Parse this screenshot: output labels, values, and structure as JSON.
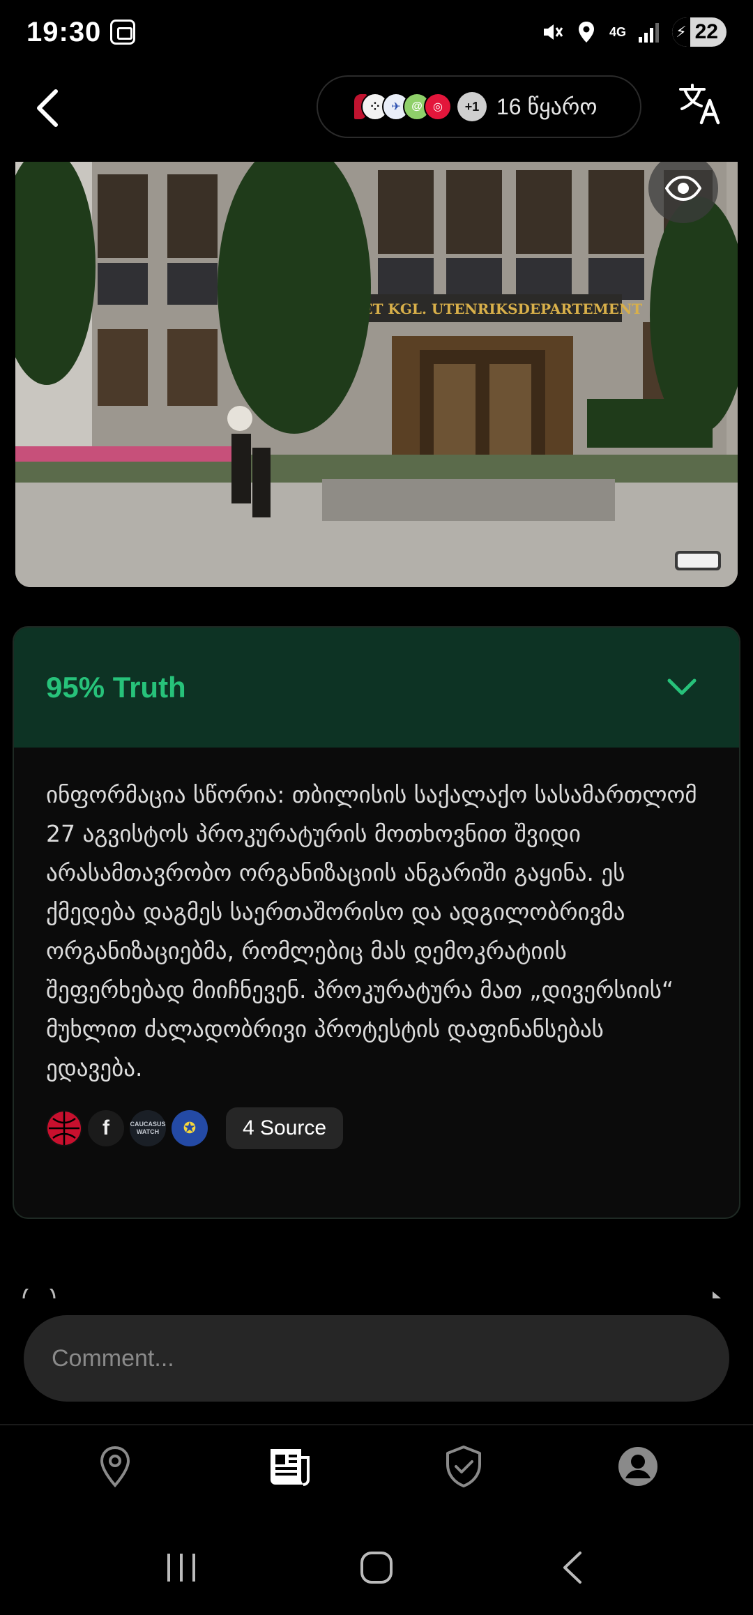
{
  "status_bar": {
    "time": "19:30",
    "network": "4G",
    "battery": "22"
  },
  "header": {
    "sources_more": "+1",
    "sources_label": "16 წყარო"
  },
  "article": {
    "truth_label": "95% Truth",
    "body": "ინფორმაცია სწორია: თბილისის საქალაქო სასამართლომ 27 აგვისტოს პროკურატურის მოთხოვნით შვიდი არასამთავრობო ორგანიზაციის ანგარიში გაყინა. ეს ქმედება დაგმეს საერთაშორისო და ადგილობრივმა ორგანიზაციებმა, რომლებიც მას დემოკრატიის შეფერხებად მიიჩნევენ. პროკურატურა მათ „დივერსიის“ მუხლით ძალადობრივი პროტესტის დაფინანსებას ედავება.",
    "source_chip": "4 Source",
    "image_sign": "DET KGL. UTENRIKSDEPARTEMENT",
    "source_logo_caucasus": "CAUCASUS WATCH"
  },
  "comment": {
    "placeholder": "Comment..."
  },
  "colors": {
    "accent_green": "#27c27a",
    "card_header_bg": "#0d3324"
  }
}
